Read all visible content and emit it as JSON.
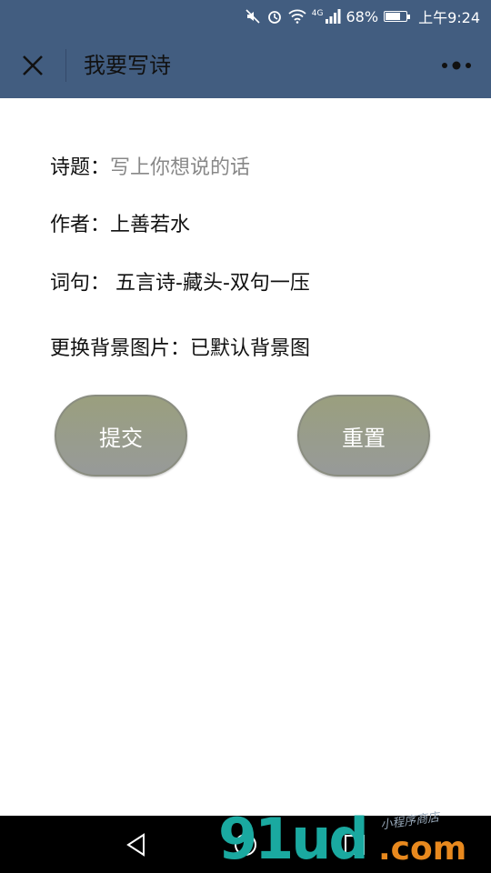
{
  "status_bar": {
    "icons": [
      "mute-icon",
      "alarm-icon",
      "wifi-icon",
      "4g-signal-icon",
      "battery-icon"
    ],
    "network": "4G",
    "battery_percent": "68%",
    "battery_level": 0.68,
    "time": "上午9:24"
  },
  "nav": {
    "title": "我要写诗",
    "close_icon": "close-icon",
    "more_icon": "more-icon"
  },
  "form": {
    "title_label": "诗题：",
    "title_placeholder": "写上你想说的话",
    "author_label": "作者：",
    "author_value": "上善若水",
    "verse_label": "词句：",
    "verse_value": "五言诗-藏头-双句一压",
    "bg_label": "更换背景图片：",
    "bg_value": "已默认背景图"
  },
  "buttons": {
    "submit": "提交",
    "reset": "重置"
  },
  "watermark": {
    "logo": "91ud",
    "suffix": ".com",
    "tagline": "小程序商店"
  },
  "colors": {
    "header_bg": "#425d80",
    "button_bg": "#9a9f7e",
    "watermark_teal": "#1aa9a0",
    "watermark_orange": "#e8891e"
  }
}
